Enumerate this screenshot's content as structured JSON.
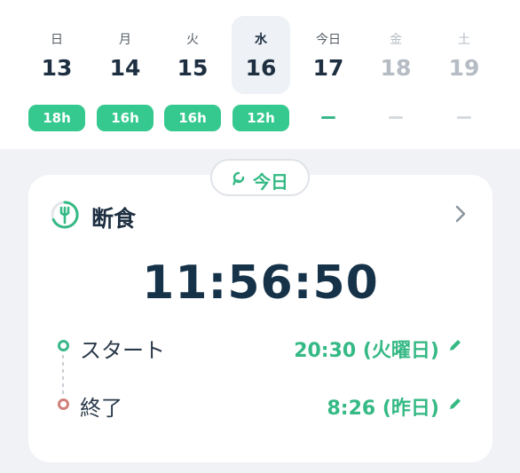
{
  "week": [
    {
      "dow": "日",
      "date": "13",
      "hours": "18h",
      "state": "past"
    },
    {
      "dow": "月",
      "date": "14",
      "hours": "16h",
      "state": "past"
    },
    {
      "dow": "火",
      "date": "15",
      "hours": "16h",
      "state": "past"
    },
    {
      "dow": "水",
      "date": "16",
      "hours": "12h",
      "state": "selected"
    },
    {
      "dow": "今日",
      "date": "17",
      "hours": "",
      "state": "today"
    },
    {
      "dow": "金",
      "date": "18",
      "hours": "",
      "state": "future"
    },
    {
      "dow": "土",
      "date": "19",
      "hours": "",
      "state": "future"
    }
  ],
  "today_button": {
    "label": "今日"
  },
  "fasting_card": {
    "title": "断食",
    "timer": "11:56:50",
    "start": {
      "label": "スタート",
      "value": "20:30 (火曜日)"
    },
    "end": {
      "label": "終了",
      "value": "8:26 (昨日)"
    }
  },
  "colors": {
    "accent": "#35c98f",
    "dark": "#153249",
    "end_dot": "#d0807a"
  },
  "icons": [
    "fasting-fork-icon",
    "chevron-right-icon",
    "rotate-icon",
    "pencil-icon"
  ]
}
